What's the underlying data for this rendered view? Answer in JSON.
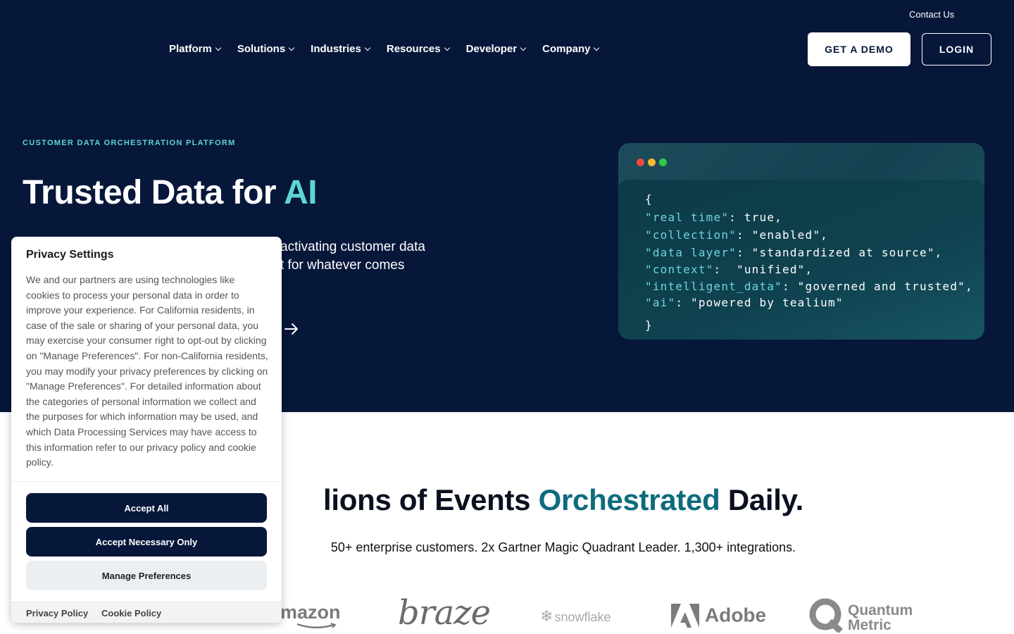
{
  "header": {
    "contact_label": "Contact Us",
    "nav": [
      {
        "label": "Platform"
      },
      {
        "label": "Solutions"
      },
      {
        "label": "Industries"
      },
      {
        "label": "Resources"
      },
      {
        "label": "Developer"
      },
      {
        "label": "Company"
      }
    ],
    "demo_label": "GET A DEMO",
    "login_label": "LOGIN"
  },
  "hero": {
    "eyebrow": "CUSTOMER DATA ORCHESTRATION PLATFORM",
    "title_prefix": "Trusted Data for ",
    "title_accent": "AI",
    "desc_line1": "activating customer data",
    "desc_line2": "t for whatever comes",
    "accent_color": "#5fd4d4"
  },
  "code_card": {
    "dot_colors": [
      "#ee4a3e",
      "#f5b82e",
      "#2fc84a"
    ],
    "open_brace": "{",
    "close_brace": "}",
    "lines": [
      {
        "key": "\"real time\"",
        "sep": ": ",
        "value": "true,"
      },
      {
        "key": "\"collection\"",
        "sep": ": ",
        "value": "\"enabled\","
      },
      {
        "key": "\"data layer\"",
        "sep": ": ",
        "value": "\"standardized at source\","
      },
      {
        "key": "\"context\"",
        "sep": ":  ",
        "value": "\"unified\","
      },
      {
        "key": "\"intelligent_data\"",
        "sep": ": ",
        "value": "\"governed and trusted\","
      },
      {
        "key": "\"ai\"",
        "sep": ": ",
        "value": "\"powered by tealium\""
      }
    ]
  },
  "stats": {
    "title_prefix": "lions of Events ",
    "title_accent": "Orchestrated",
    "title_suffix": " Daily.",
    "subtitle": "50+ enterprise customers. 2x Gartner Magic Quadrant Leader. 1,300+ integrations."
  },
  "logos": {
    "amazon": "mazon",
    "braze": "braze",
    "snowflake": "snowflake",
    "adobe": "Adobe",
    "quantum_line1": "Quantum",
    "quantum_line2": "Metric"
  },
  "privacy": {
    "title": "Privacy Settings",
    "text": "We and our partners are using technologies like cookies to process your personal data in order to improve your experience. For California residents, in case of the sale or sharing of your personal data, you may exercise your consumer right to opt-out by clicking on \"Manage Preferences\". For non-California residents, you may modify your privacy preferences by clicking on \"Manage Preferences\". For detailed information about the categories of personal information we collect and the purposes for which information may be used, and which Data Processing Services may have access to this information refer to our privacy policy and cookie policy.",
    "accept_all": "Accept All",
    "accept_necessary": "Accept Necessary Only",
    "manage": "Manage Preferences",
    "privacy_policy": "Privacy Policy",
    "cookie_policy": "Cookie Policy"
  }
}
